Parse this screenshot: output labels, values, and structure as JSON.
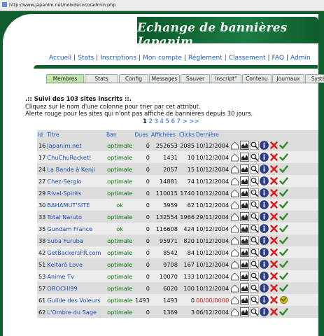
{
  "browser": {
    "url": "http://www.japanim.net/noixdecoco/admin.php"
  },
  "banner": {
    "title": "Echange de bannières Japanim"
  },
  "nav": {
    "links": [
      "Accueil",
      "Stats",
      "Inscriptions",
      "Mon compte",
      "Règlement",
      "Classement",
      "FAQ",
      "Admin"
    ],
    "separator": "|"
  },
  "tabs": [
    {
      "label": "Membres",
      "active": true
    },
    {
      "label": "Stats",
      "active": false
    },
    {
      "label": "Config",
      "active": false
    },
    {
      "label": "Messages",
      "active": false
    },
    {
      "label": "Sauver",
      "active": false
    },
    {
      "label": "Inscript°",
      "active": false
    },
    {
      "label": "Contenu",
      "active": false
    },
    {
      "label": "Journaux",
      "active": false
    },
    {
      "label": "Système",
      "active": false
    }
  ],
  "section": {
    "title": ".:: Suivi des 103 sites inscrits ::.",
    "line1": "Cliquez sur le nom d'une colonne pour trier par cet attribut.",
    "line2": "Alerte rouge pour les sites qui n'ont pas affiché de bannières depuis 30 jours."
  },
  "pager": {
    "current": "1",
    "pages": [
      "2",
      "3",
      "4",
      "5",
      "6",
      "7"
    ],
    "next": ">",
    "last": ">>"
  },
  "table": {
    "headers": [
      "Id",
      "Titre",
      "Ban",
      "Dues",
      "Affichées",
      "Clicks",
      "Dernière"
    ],
    "rows": [
      {
        "id": "16",
        "title": "Japanim.net",
        "ban": "optimale",
        "dues": "0",
        "shown": "252653",
        "clicks": "2085",
        "last": "10/12/2004",
        "alert": false
      },
      {
        "id": "17",
        "title": "ChuChuRocket!",
        "ban": "optimale",
        "dues": "0",
        "shown": "1431",
        "clicks": "10",
        "last": "10/12/2004",
        "alert": false
      },
      {
        "id": "24",
        "title": "La Bande à Kenji",
        "ban": "optimale",
        "dues": "0",
        "shown": "2057",
        "clicks": "15",
        "last": "10/12/2004",
        "alert": false
      },
      {
        "id": "27",
        "title": "Chez-Sergio",
        "ban": "optimale",
        "dues": "0",
        "shown": "14881",
        "clicks": "74",
        "last": "10/12/2004",
        "alert": false
      },
      {
        "id": "29",
        "title": "Rival-Spirits",
        "ban": "optimale",
        "dues": "0",
        "shown": "110015",
        "clicks": "1740",
        "last": "10/12/2004",
        "alert": false
      },
      {
        "id": "30",
        "title": "BAHAMUT'SITE",
        "ban": "ok",
        "dues": "0",
        "shown": "3959",
        "clicks": "62",
        "last": "10/12/2004",
        "alert": false
      },
      {
        "id": "33",
        "title": "Total Naruto",
        "ban": "optimale",
        "dues": "0",
        "shown": "132554",
        "clicks": "1966",
        "last": "29/11/2004",
        "alert": false
      },
      {
        "id": "35",
        "title": "Gundam France",
        "ban": "ok",
        "dues": "0",
        "shown": "116608",
        "clicks": "424",
        "last": "10/12/2004",
        "alert": false
      },
      {
        "id": "38",
        "title": "Suba Furuba",
        "ban": "optimale",
        "dues": "0",
        "shown": "95971",
        "clicks": "820",
        "last": "10/12/2004",
        "alert": false
      },
      {
        "id": "42",
        "title": "GetBackersFR.com",
        "ban": "optimale",
        "dues": "0",
        "shown": "8542",
        "clicks": "84",
        "last": "10/12/2004",
        "alert": false
      },
      {
        "id": "51",
        "title": "Keitarô Love",
        "ban": "optimale",
        "dues": "0",
        "shown": "9708",
        "clicks": "167",
        "last": "10/12/2004",
        "alert": false
      },
      {
        "id": "53",
        "title": "Anime Tv",
        "ban": "optimale",
        "dues": "0",
        "shown": "10070",
        "clicks": "133",
        "last": "10/12/2004",
        "alert": false
      },
      {
        "id": "57",
        "title": "OROCHI99",
        "ban": "optimale",
        "dues": "0",
        "shown": "6020",
        "clicks": "100",
        "last": "10/12/2004",
        "alert": false
      },
      {
        "id": "61",
        "title": "Guilde des Voleurs",
        "ban": "optimale",
        "dues": "1493",
        "shown": "1493",
        "clicks": "0",
        "last": "00/00/0000",
        "alert": true
      },
      {
        "id": "62",
        "title": "L'Ombre du Sage",
        "ban": "optimale",
        "dues": "0",
        "shown": "1369",
        "clicks": "3",
        "last": "06/12/2004",
        "alert": false
      }
    ]
  },
  "icons": [
    "edit-page-icon",
    "stats-chart-icon",
    "magnify-icon",
    "info-icon",
    "delete-icon",
    "approve-check-icon"
  ],
  "colors": {
    "frame_green": "#0f5f2e",
    "link_blue": "#1b5bd0",
    "ban_green": "#0a7a0a",
    "alert_red": "#d01818",
    "active_tab": "#c3e6b0"
  }
}
